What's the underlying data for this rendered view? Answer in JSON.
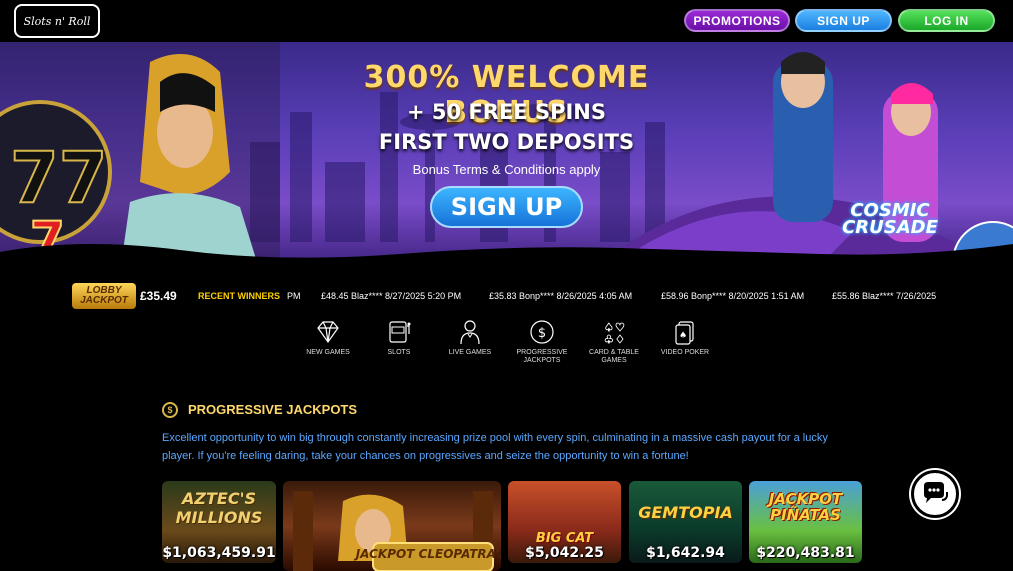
{
  "header": {
    "logo_text": "Slots n' Roll",
    "promotions_label": "PROMOTIONS",
    "signup_label": "SIGN UP",
    "login_label": "LOG IN"
  },
  "banner": {
    "headline": "300% WELCOME BONUS",
    "line2": "+ 50 FREE SPINS",
    "line3": "FIRST TWO DEPOSITS",
    "terms": "Bonus Terms & Conditions apply",
    "cta": "SIGN UP",
    "game_logo": "COSMIC CRUSADE"
  },
  "ticker": {
    "lobby_label": "LOBBY JACKPOT",
    "lobby_amount": "£35.49",
    "label": "RECENT WINNERS",
    "items": [
      "PM",
      "£48.45  Blaz****  8/27/2025 5:20 PM",
      "£35.83  Bonp****  8/26/2025 4:05 AM",
      "£58.96  Bonp****  8/20/2025 1:51 AM",
      "£55.86  Blaz****  7/26/2025"
    ]
  },
  "categories": [
    {
      "label": "NEW GAMES",
      "icon": "diamond-icon"
    },
    {
      "label": "SLOTS",
      "icon": "slot-machine-icon"
    },
    {
      "label": "LIVE GAMES",
      "icon": "dealer-icon"
    },
    {
      "label": "PROGRESSIVE JACKPOTS",
      "icon": "dollar-coin-icon"
    },
    {
      "label": "CARD & TABLE GAMES",
      "icon": "card-suits-icon"
    },
    {
      "label": "VIDEO POKER",
      "icon": "playing-card-icon"
    }
  ],
  "section": {
    "title": "PROGRESSIVE JACKPOTS",
    "description": "Excellent opportunity to win big through constantly increasing prize pool with every spin, culminating in a massive cash payout for a lucky player. If you're feeling daring, take your chances on progressives and seize the opportunity to win a fortune!"
  },
  "games": [
    {
      "title": "AZTEC'S MILLIONS",
      "amount": "$1,063,459.91"
    },
    {
      "title": "JACKPOT CLEOPATRA'S",
      "amount": ""
    },
    {
      "title": "BIG CAT",
      "amount": "$5,042.25"
    },
    {
      "title": "GEMTOPIA",
      "amount": "$1,642.94"
    },
    {
      "title": "JACKPOT PIÑATAS",
      "amount": "$220,483.81"
    }
  ],
  "colors": {
    "promotions": "#7a18bf",
    "signup": "#2a93ee",
    "login": "#2cc23a",
    "section_title": "#ffd86b",
    "section_text": "#5aa8ff"
  }
}
